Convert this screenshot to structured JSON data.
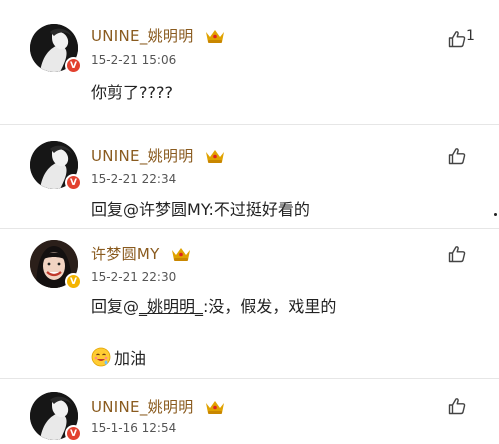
{
  "comments": [
    {
      "username": "UNINE_姚明明",
      "timestamp": "15-2-21 15:06",
      "text": "你剪了????",
      "like_count": "1",
      "badge": "V"
    },
    {
      "username": "UNINE_姚明明",
      "timestamp": "15-2-21 22:34",
      "reply_prefix": "回复",
      "reply_target": "@许梦圆MY",
      "reply_text": ":不过挺好看的",
      "badge": "V"
    },
    {
      "username": "许梦圆MY",
      "timestamp": "15-2-21 22:30",
      "reply_prefix": "回复@",
      "reply_target": "_姚明明_",
      "reply_text": ":没，假发，戏里的",
      "extra_text": "加油",
      "badge": "V"
    },
    {
      "username": "UNINE_姚明明",
      "timestamp": "15-1-16 12:54",
      "badge": "V"
    }
  ],
  "colors": {
    "username": "#8a5b1f",
    "crown": "#e0a200",
    "verified_red": "#e2412f",
    "verified_gold": "#f4b400"
  },
  "icons": {
    "like": "thumbs-up-icon",
    "crown": "crown-icon",
    "emoji": "drooling-face-emoji-icon"
  }
}
